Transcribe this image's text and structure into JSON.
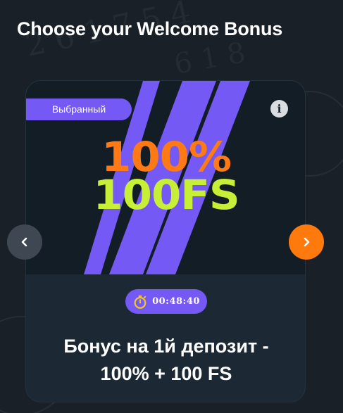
{
  "page": {
    "title": "Choose your Welcome Bonus"
  },
  "card": {
    "selected_badge": "Выбранный",
    "info_icon": "info-icon",
    "banner": {
      "line1": "100%",
      "line2": "100FS",
      "line1_color": "#ff7a14",
      "line2_color": "#c6ef35",
      "stripe_color": "#7459f5"
    },
    "timer": {
      "icon": "stopwatch-icon",
      "value": "00:48:40"
    },
    "title_line1": "Бонус на 1й депозит -",
    "title_line2": "100% + 100 FS"
  },
  "carousel": {
    "prev_icon": "chevron-left-icon",
    "next_icon": "chevron-right-icon",
    "prev_color": "#3f4852",
    "next_color": "#ff7a0d"
  },
  "colors": {
    "background": "#1a2027",
    "card": "#1c2935",
    "accent_purple": "#7459f5",
    "accent_orange": "#ff7a0d"
  }
}
